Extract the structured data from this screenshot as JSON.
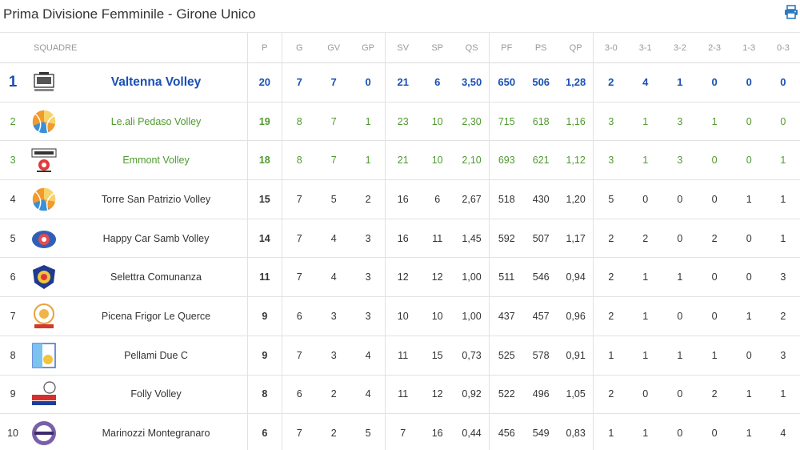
{
  "header": {
    "title": "Prima Divisione Femminile - Girone Unico",
    "print_icon": "printer-icon"
  },
  "colors": {
    "leader": "#1a4fb5",
    "promo": "#4f9a2f",
    "position": "#2b7bc2",
    "print_icon": "#2b7bc2"
  },
  "columns": [
    "SQUADRE",
    "P",
    "G",
    "GV",
    "GP",
    "SV",
    "SP",
    "QS",
    "PF",
    "PS",
    "QP",
    "3-0",
    "3-1",
    "3-2",
    "2-3",
    "1-3",
    "0-3"
  ],
  "rows": [
    {
      "pos": "1",
      "team": "Valtenna Volley",
      "logo": "valtenna-logo",
      "cls": "first",
      "p": "20",
      "g": "7",
      "gv": "7",
      "gp": "0",
      "sv": "21",
      "sp": "6",
      "qs": "3,50",
      "pf": "650",
      "ps": "506",
      "qp": "1,28",
      "w30": "2",
      "w31": "4",
      "w32": "1",
      "l23": "0",
      "l13": "0",
      "l03": "0"
    },
    {
      "pos": "2",
      "team": "Le.ali Pedaso Volley",
      "logo": "volleyball-logo",
      "cls": "promo",
      "p": "19",
      "g": "8",
      "gv": "7",
      "gp": "1",
      "sv": "23",
      "sp": "10",
      "qs": "2,30",
      "pf": "715",
      "ps": "618",
      "qp": "1,16",
      "w30": "3",
      "w31": "1",
      "w32": "3",
      "l23": "1",
      "l13": "0",
      "l03": "0"
    },
    {
      "pos": "3",
      "team": "Emmont Volley",
      "logo": "emmont-logo",
      "cls": "promo",
      "p": "18",
      "g": "8",
      "gv": "7",
      "gp": "1",
      "sv": "21",
      "sp": "10",
      "qs": "2,10",
      "pf": "693",
      "ps": "621",
      "qp": "1,12",
      "w30": "3",
      "w31": "1",
      "w32": "3",
      "l23": "0",
      "l13": "0",
      "l03": "1"
    },
    {
      "pos": "4",
      "team": "Torre San Patrizio Volley",
      "logo": "volleyball-logo",
      "cls": "",
      "p": "15",
      "g": "7",
      "gv": "5",
      "gp": "2",
      "sv": "16",
      "sp": "6",
      "qs": "2,67",
      "pf": "518",
      "ps": "430",
      "qp": "1,20",
      "w30": "5",
      "w31": "0",
      "w32": "0",
      "l23": "0",
      "l13": "1",
      "l03": "1"
    },
    {
      "pos": "5",
      "team": "Happy Car Samb Volley",
      "logo": "happycar-logo",
      "cls": "",
      "p": "14",
      "g": "7",
      "gv": "4",
      "gp": "3",
      "sv": "16",
      "sp": "11",
      "qs": "1,45",
      "pf": "592",
      "ps": "507",
      "qp": "1,17",
      "w30": "2",
      "w31": "2",
      "w32": "0",
      "l23": "2",
      "l13": "0",
      "l03": "1"
    },
    {
      "pos": "6",
      "team": "Selettra Comunanza",
      "logo": "selettra-logo",
      "cls": "",
      "p": "11",
      "g": "7",
      "gv": "4",
      "gp": "3",
      "sv": "12",
      "sp": "12",
      "qs": "1,00",
      "pf": "511",
      "ps": "546",
      "qp": "0,94",
      "w30": "2",
      "w31": "1",
      "w32": "1",
      "l23": "0",
      "l13": "0",
      "l03": "3"
    },
    {
      "pos": "7",
      "team": "Picena Frigor Le Querce",
      "logo": "picena-logo",
      "cls": "",
      "p": "9",
      "g": "6",
      "gv": "3",
      "gp": "3",
      "sv": "10",
      "sp": "10",
      "qs": "1,00",
      "pf": "437",
      "ps": "457",
      "qp": "0,96",
      "w30": "2",
      "w31": "1",
      "w32": "0",
      "l23": "0",
      "l13": "1",
      "l03": "2"
    },
    {
      "pos": "8",
      "team": "Pellami Due C",
      "logo": "pellami-logo",
      "cls": "",
      "p": "9",
      "g": "7",
      "gv": "3",
      "gp": "4",
      "sv": "11",
      "sp": "15",
      "qs": "0,73",
      "pf": "525",
      "ps": "578",
      "qp": "0,91",
      "w30": "1",
      "w31": "1",
      "w32": "1",
      "l23": "1",
      "l13": "0",
      "l03": "3"
    },
    {
      "pos": "9",
      "team": "Folly Volley",
      "logo": "folly-logo",
      "cls": "",
      "p": "8",
      "g": "6",
      "gv": "2",
      "gp": "4",
      "sv": "11",
      "sp": "12",
      "qs": "0,92",
      "pf": "522",
      "ps": "496",
      "qp": "1,05",
      "w30": "2",
      "w31": "0",
      "w32": "0",
      "l23": "2",
      "l13": "1",
      "l03": "1"
    },
    {
      "pos": "10",
      "team": "Marinozzi Montegranaro",
      "logo": "marinozzi-logo",
      "cls": "",
      "p": "6",
      "g": "7",
      "gv": "2",
      "gp": "5",
      "sv": "7",
      "sp": "16",
      "qs": "0,44",
      "pf": "456",
      "ps": "549",
      "qp": "0,83",
      "w30": "1",
      "w31": "1",
      "w32": "0",
      "l23": "0",
      "l13": "1",
      "l03": "4"
    }
  ]
}
